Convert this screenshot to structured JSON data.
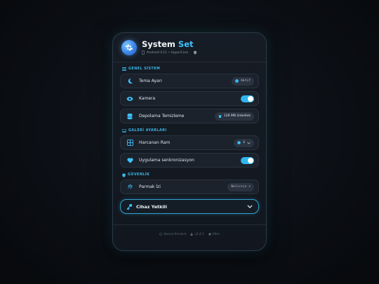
{
  "header": {
    "title_main": "System",
    "title_accent": "Set",
    "subtitle": "Android V.11 • HyperCore"
  },
  "sections": {
    "general": "GENEL SİSTEM",
    "gallery": "GALERİ AYARLARI",
    "security": "GÜVENLİK"
  },
  "rows": {
    "theme": {
      "label": "Tema Ayarı",
      "value": "Aktif"
    },
    "camera": {
      "label": "Kamera",
      "enabled": true
    },
    "storage": {
      "label": "Depolama Temizleme",
      "value": "128 MB önbellek"
    },
    "ram": {
      "label": "Harcanan Ram",
      "value": "2"
    },
    "sync": {
      "label": "Uygulama senkronizasyon",
      "enabled": true
    },
    "fingerprint": {
      "label": "Parmak İzi",
      "value": "Belirsiz ▾"
    }
  },
  "cta": {
    "label": "Cihaz Yetkili"
  },
  "footer": {
    "secure": "Secure Enclave",
    "version": "v2.4.1",
    "ultra": "Ultra"
  },
  "colors": {
    "accent": "#3ec3ff",
    "toggle_on": "#2fb6ee"
  }
}
